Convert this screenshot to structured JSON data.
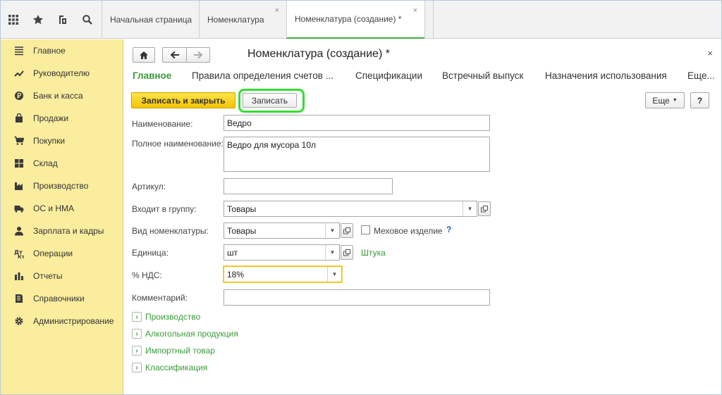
{
  "topbar": {
    "icons": [
      "apps-grid-icon",
      "star-icon",
      "history-icon",
      "search-icon"
    ],
    "tabs": [
      {
        "label": "Начальная страница",
        "closable": false
      },
      {
        "label": "Номенклатура",
        "closable": true
      },
      {
        "label": "Номенклатура (создание) *",
        "closable": true,
        "active": true
      }
    ],
    "close_glyph": "×"
  },
  "sidebar": {
    "items": [
      {
        "label": "Главное",
        "icon": "menu-lines-icon"
      },
      {
        "label": "Руководителю",
        "icon": "trend-icon"
      },
      {
        "label": "Банк и касса",
        "icon": "coin-icon"
      },
      {
        "label": "Продажи",
        "icon": "shopping-bag-icon"
      },
      {
        "label": "Покупки",
        "icon": "cart-icon"
      },
      {
        "label": "Склад",
        "icon": "warehouse-grid-icon"
      },
      {
        "label": "Производство",
        "icon": "factory-icon"
      },
      {
        "label": "ОС и НМА",
        "icon": "truck-icon"
      },
      {
        "label": "Зарплата и кадры",
        "icon": "person-icon"
      },
      {
        "label": "Операции",
        "icon": "operations-icon"
      },
      {
        "label": "Отчеты",
        "icon": "bar-chart-icon"
      },
      {
        "label": "Справочники",
        "icon": "book-icon"
      },
      {
        "label": "Администрирование",
        "icon": "gear-icon"
      }
    ]
  },
  "form": {
    "title": "Номенклатура (создание) *",
    "close_glyph": "×",
    "section_tabs": [
      {
        "label": "Главное",
        "active": true
      },
      {
        "label": "Правила определения счетов ..."
      },
      {
        "label": "Спецификации"
      },
      {
        "label": "Встречный выпуск"
      },
      {
        "label": "Назначения использования"
      },
      {
        "label": "Еще..."
      }
    ],
    "toolbar": {
      "save_close_label": "Записать и закрыть",
      "save_label": "Записать",
      "more_label": "Еще",
      "help_label": "?"
    },
    "fields": {
      "name_label": "Наименование:",
      "name_value": "Ведро",
      "full_name_label": "Полное наименование:",
      "full_name_value": "Ведро для мусора 10л",
      "article_label": "Артикул:",
      "article_value": "",
      "group_label": "Входит в группу:",
      "group_value": "Товары",
      "kind_label": "Вид номенклатуры:",
      "kind_value": "Товары",
      "fur_label": "Меховое изделие",
      "fur_checked": false,
      "fur_help": "?",
      "unit_label": "Единица:",
      "unit_value": "шт",
      "unit_link": "Штука",
      "vat_label": "% НДС:",
      "vat_value": "18%",
      "comment_label": "Комментарий:",
      "comment_value": ""
    },
    "groups": [
      {
        "label": "Производство"
      },
      {
        "label": "Алкогольная продукция"
      },
      {
        "label": "Импортный товар"
      },
      {
        "label": "Классификация"
      }
    ]
  },
  "colors": {
    "accent_green": "#3a9b3a",
    "sidebar_bg": "#fbed9e",
    "primary_button": "#f3c400",
    "highlight": "#33dd33"
  }
}
